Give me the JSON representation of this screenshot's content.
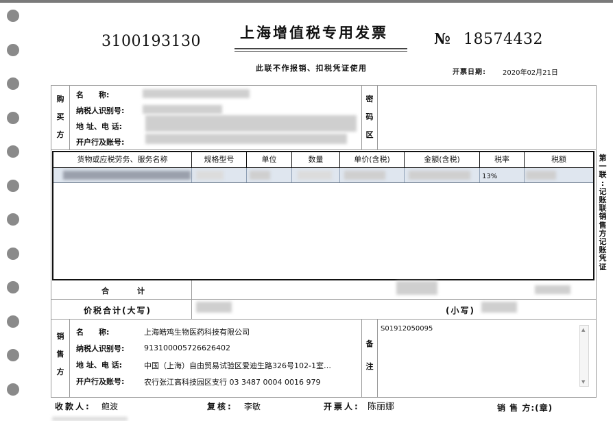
{
  "header": {
    "invoice_code": "3100193130",
    "title": "上海增值税专用发票",
    "subtitle": "此联不作报销、扣税凭证使用",
    "no_sign": "№",
    "invoice_number": "18574432",
    "issue_date_label": "开票日期:",
    "issue_date": "2020年02月21日"
  },
  "buyer": {
    "section_label": [
      "购",
      "买",
      "方"
    ],
    "name_label": "名　　称:",
    "tax_id_label": "纳税人识别号:",
    "address_label": "地 址、电 话:",
    "bank_label": "开户行及账号:"
  },
  "cipher_label": [
    "密",
    "码",
    "区"
  ],
  "items_table": {
    "columns": [
      "货物或应税劳务、服务名称",
      "规格型号",
      "单位",
      "数量",
      "单价(含税)",
      "金额(含税)",
      "税率",
      "税额"
    ],
    "rows": [
      {
        "tax_rate": "13%"
      }
    ]
  },
  "totals": {
    "total_label": "合　　　计",
    "total_in_words_label": "价税合计(大写)",
    "small_label": "(小写)"
  },
  "seller": {
    "section_label": [
      "销",
      "售",
      "方"
    ],
    "name_label": "名　　称:",
    "name": "上海皓鸡生物医药科技有限公司",
    "tax_id_label": "纳税人识别号:",
    "tax_id": "913100005726626402",
    "address_label": "地 址、电 话:",
    "address": "中国（上海）自由贸易试验区爱迪生路326号102-1室…",
    "bank_label": "开户行及账号:",
    "bank": "农行张江高科技园区支行 03 3487 0004 0016 979"
  },
  "remarks": {
    "label": [
      "备",
      "注"
    ],
    "text": "S01912050095"
  },
  "side_copy_label": [
    "第",
    "一",
    "联",
    ":",
    "记",
    "账",
    "联",
    " ",
    "销",
    "售",
    "方",
    "记",
    "账",
    "凭",
    "证"
  ],
  "footer": {
    "payee_label": "收款人:",
    "payee": "鲍波",
    "reviewer_label": "复核:",
    "reviewer": "李敏",
    "drawer_label": "开票人:",
    "drawer": "陈丽娜",
    "seller_stamp_label": "销 售 方:(章)"
  }
}
